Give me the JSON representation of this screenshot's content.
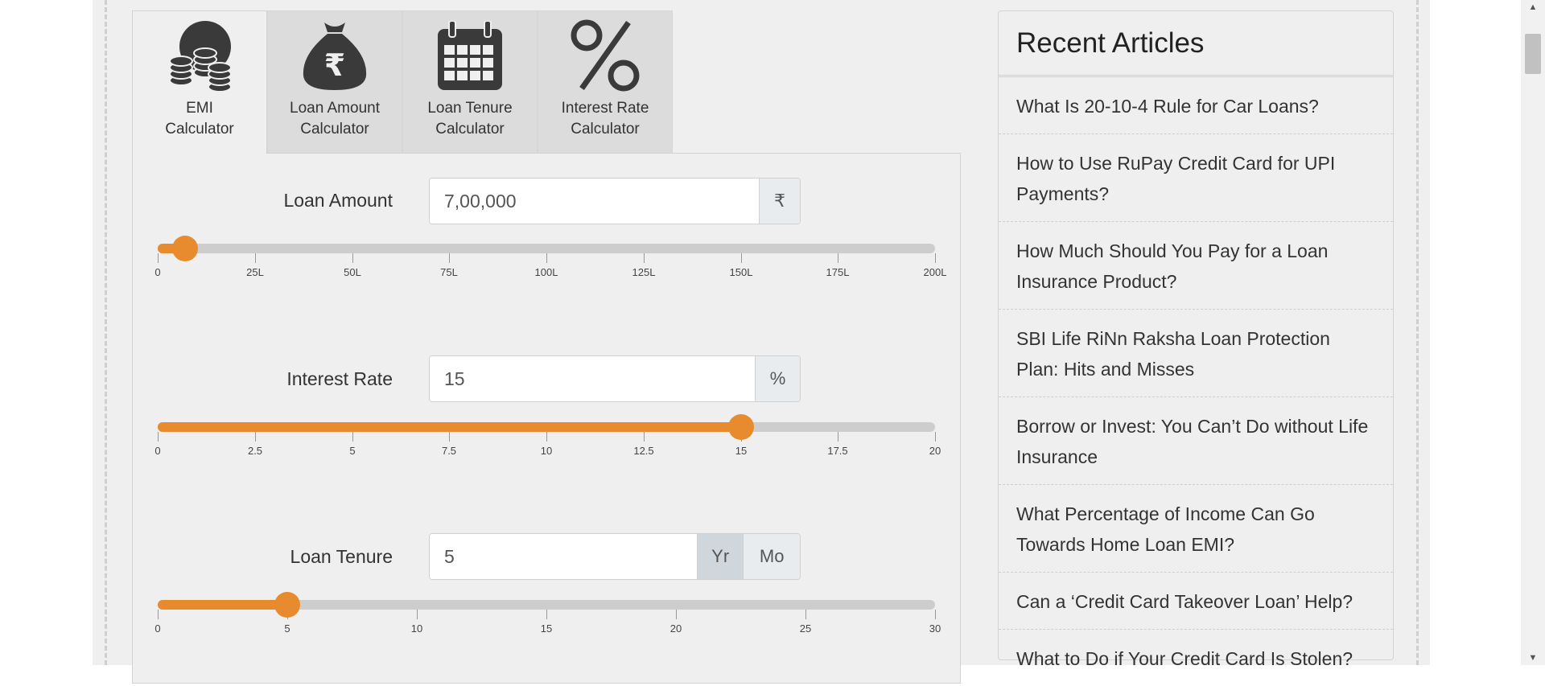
{
  "tabs": [
    {
      "label_line1": "EMI",
      "label_line2": "Calculator",
      "icon": "coins-icon",
      "active": true
    },
    {
      "label_line1": "Loan Amount",
      "label_line2": "Calculator",
      "icon": "money-bag-rupee-icon",
      "active": false
    },
    {
      "label_line1": "Loan Tenure",
      "label_line2": "Calculator",
      "icon": "calendar-icon",
      "active": false
    },
    {
      "label_line1": "Interest Rate",
      "label_line2": "Calculator",
      "icon": "percent-icon",
      "active": false
    }
  ],
  "calculator": {
    "loan_amount": {
      "label": "Loan Amount",
      "value": "7,00,000",
      "unit": "₹",
      "slider_fraction": 0.035,
      "ticks": [
        "0",
        "25L",
        "50L",
        "75L",
        "100L",
        "125L",
        "150L",
        "175L",
        "200L"
      ]
    },
    "interest_rate": {
      "label": "Interest Rate",
      "value": "15",
      "unit": "%",
      "slider_fraction": 0.75,
      "ticks": [
        "0",
        "2.5",
        "5",
        "7.5",
        "10",
        "12.5",
        "15",
        "17.5",
        "20"
      ]
    },
    "loan_tenure": {
      "label": "Loan Tenure",
      "value": "5",
      "unit_year": "Yr",
      "unit_month": "Mo",
      "selected_unit": "Yr",
      "slider_fraction": 0.1667,
      "ticks": [
        "0",
        "5",
        "10",
        "15",
        "20",
        "25",
        "30"
      ]
    }
  },
  "recent_articles": {
    "title": "Recent Articles",
    "items": [
      "What Is 20-10-4 Rule for Car Loans?",
      "How to Use RuPay Credit Card for UPI Payments?",
      "How Much Should You Pay for a Loan Insurance Product?",
      "SBI Life RiNn Raksha Loan Protection Plan: Hits and Misses",
      "Borrow or Invest: You Can’t Do without Life Insurance",
      "What Percentage of Income Can Go Towards Home Loan EMI?",
      "Can a ‘Credit Card Takeover Loan’ Help?",
      "What to Do if Your Credit Card Is Stolen?"
    ]
  },
  "colors": {
    "accent": "#e88b2e",
    "track": "#cdcdcd",
    "panel_bg": "#efefef",
    "icon_dark": "#3a3a3a"
  }
}
